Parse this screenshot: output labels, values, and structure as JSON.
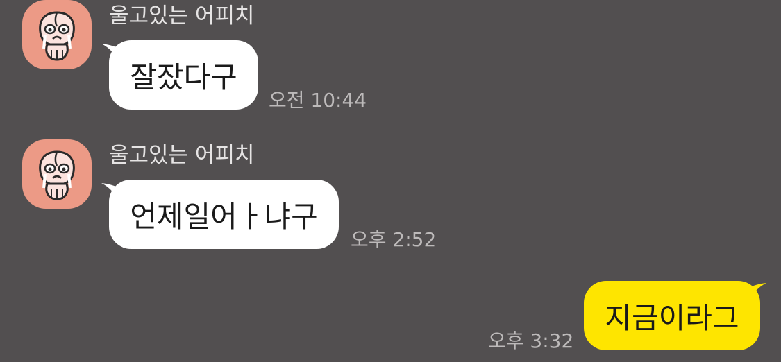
{
  "messages": [
    {
      "sender": "울고있는 어피치",
      "text": "잘잤다구",
      "time": "오전 10:44",
      "avatar_icon": "apeach-crying-icon"
    },
    {
      "sender": "울고있는 어피치",
      "text": "언제일어ㅏ냐구",
      "time": "오후 2:52",
      "avatar_icon": "apeach-crying-icon"
    },
    {
      "text": "지금이라그",
      "time": "오후 3:32"
    }
  ],
  "colors": {
    "background": "#524f50",
    "incoming_bubble": "#ffffff",
    "outgoing_bubble": "#fee500",
    "avatar_bg": "#ec9a86",
    "name_text": "#e6e4e4",
    "timestamp_text": "#bdbaba"
  }
}
